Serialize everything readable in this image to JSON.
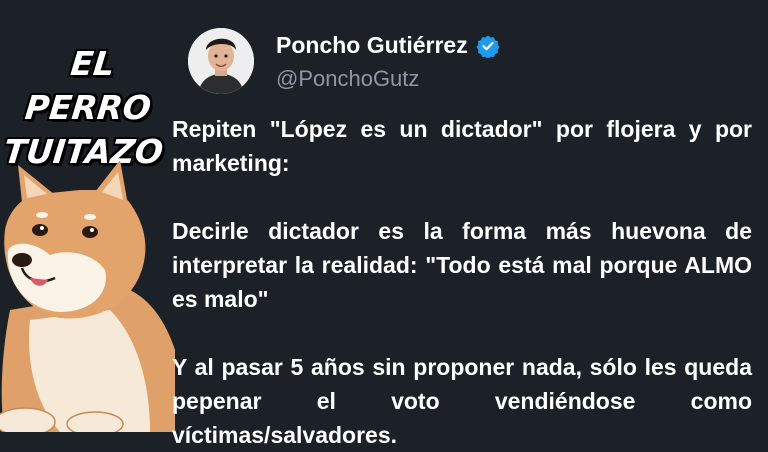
{
  "brand": {
    "line1": "EL PERRO",
    "line2": "TUITAZO"
  },
  "author": {
    "name": "Poncho Gutiérrez",
    "handle": "@PonchoGutz",
    "verified": true
  },
  "tweet": {
    "paragraphs": [
      "Repiten \"López es un dictador\" por flojera y por marketing:",
      "Decirle dictador es la forma más huevona de interpretar la realidad: \"Todo está mal porque ALMO es malo\"",
      "Y al pasar 5 años sin proponer nada, sólo les queda pepenar el voto vendiéndose como víctimas/salvadores."
    ]
  },
  "colors": {
    "background": "#1c2128",
    "text": "#ffffff",
    "handle": "#8b98a5",
    "verified_badge": "#1d9bf0"
  },
  "icons": {
    "verified": "verified-badge-icon",
    "mascot": "shiba-dog-mascot",
    "avatar": "profile-photo"
  }
}
